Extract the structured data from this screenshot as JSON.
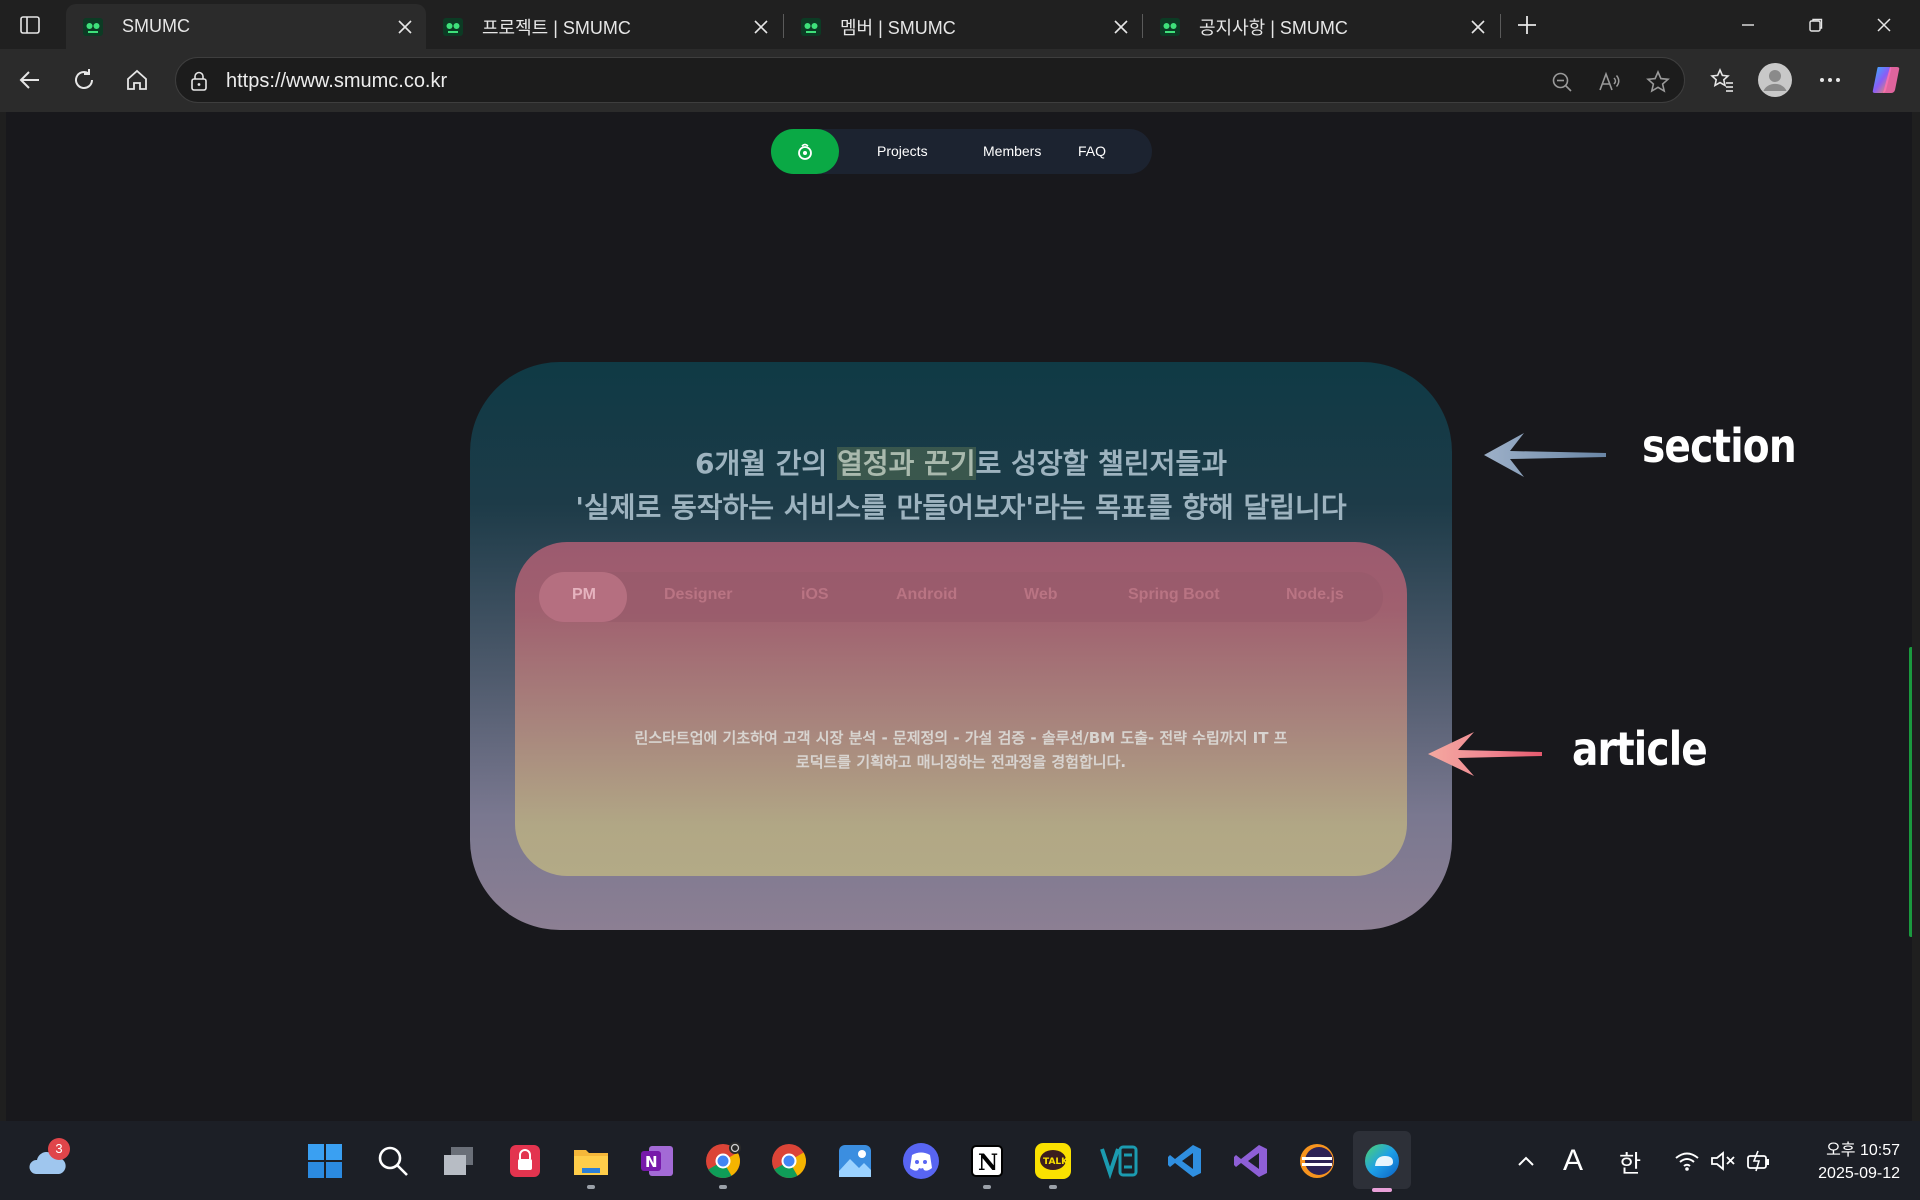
{
  "browser": {
    "tabs": [
      {
        "title": "SMUMC",
        "active": true
      },
      {
        "title": "프로젝트 | SMUMC",
        "active": false
      },
      {
        "title": "멤버 | SMUMC",
        "active": false
      },
      {
        "title": "공지사항 | SMUMC",
        "active": false
      }
    ],
    "url": "https://www.smumc.co.kr"
  },
  "site": {
    "nav": {
      "links": [
        "Projects",
        "Members",
        "FAQ"
      ]
    },
    "section": {
      "heading_line1_before": "6개월 간의 ",
      "heading_line1_highlight": "열정과 끈기",
      "heading_line1_after": "로 성장할 챌린저들과",
      "heading_line2": "'실제로 동작하는 서비스를 만들어보자'라는 목표를 향해 달립니다"
    },
    "article": {
      "roles": [
        "PM",
        "Designer",
        "iOS",
        "Android",
        "Web",
        "Spring Boot",
        "Node.js"
      ],
      "selected_role": "PM",
      "description_line1": "린스타트업에 기초하여 고객 시장 분석 - 문제정의 - 가설 검증 - 솔루션/BM 도출- 전략 수립까지 IT 프",
      "description_line2": "로덕트를 기획하고 매니징하는 전과정을 경험합니다."
    }
  },
  "annotations": {
    "section_label": "section",
    "article_label": "article"
  },
  "taskbar": {
    "weather_badge": "3",
    "ime_label": "A",
    "lang_label": "한",
    "time": "오후 10:57",
    "date": "2025-09-12"
  },
  "colors": {
    "brand_green": "#0aa945",
    "page_bg": "#18181c"
  }
}
